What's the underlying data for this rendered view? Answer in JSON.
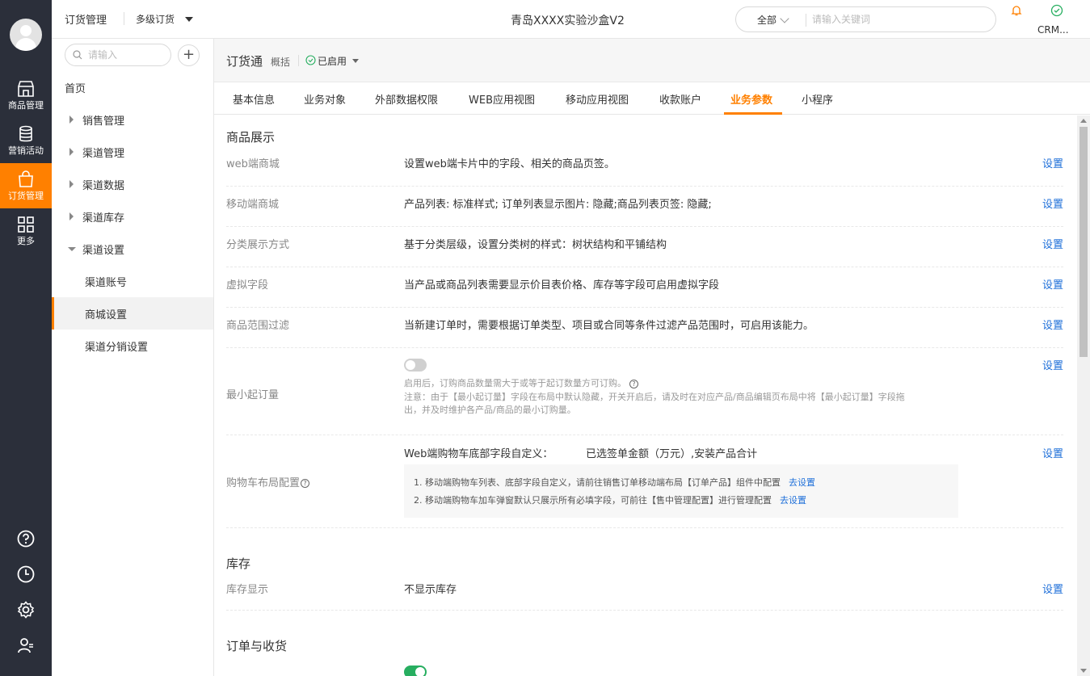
{
  "rail": {
    "items": [
      {
        "label": "商品管理",
        "icon": "store-icon"
      },
      {
        "label": "营销活动",
        "icon": "database-icon"
      },
      {
        "label": "订货管理",
        "icon": "shopping-bag-icon"
      },
      {
        "label": "更多",
        "icon": "grid-icon"
      }
    ],
    "active_index": 2
  },
  "header": {
    "crumb1": "订货管理",
    "crumb2": "多级订货",
    "center_title": "青岛XXXX实验沙盒V2",
    "search_scope": "全部",
    "search_placeholder": "请输入关键词",
    "crm_label": "CRM..."
  },
  "nav": {
    "search_placeholder": "请输入",
    "items": [
      {
        "label": "首页"
      },
      {
        "label": "销售管理"
      },
      {
        "label": "渠道管理"
      },
      {
        "label": "渠道数据"
      },
      {
        "label": "渠道库存"
      },
      {
        "label": "渠道设置"
      },
      {
        "label": "渠道账号"
      },
      {
        "label": "商城设置"
      },
      {
        "label": "渠道分销设置"
      }
    ]
  },
  "page": {
    "title": "订货通",
    "subtitle": "概括",
    "status": "已启用"
  },
  "tabs": [
    "基本信息",
    "业务对象",
    "外部数据权限",
    "WEB应用视图",
    "移动应用视图",
    "收款账户",
    "业务参数",
    "小程序"
  ],
  "active_tab": 6,
  "sections": {
    "product_display": "商品展示",
    "inventory": "库存",
    "order": "订单与收货"
  },
  "rows": {
    "web_mall": {
      "label": "web端商城",
      "value": "设置web端卡片中的字段、相关的商品页签。",
      "action": "设置"
    },
    "mobile_mall": {
      "label": "移动端商城",
      "value": "产品列表: 标准样式; 订单列表显示图片: 隐藏;商品列表页签: 隐藏;",
      "action": "设置"
    },
    "category": {
      "label": "分类展示方式",
      "value": "基于分类层级，设置分类树的样式：树状结构和平铺结构",
      "action": "设置"
    },
    "virtual": {
      "label": "虚拟字段",
      "value": "当产品或商品列表需要显示价目表价格、库存等字段可启用虚拟字段",
      "action": "设置"
    },
    "range": {
      "label": "商品范围过滤",
      "value": "当新建订单时，需要根据订单类型、项目或合同等条件过滤产品范围时，可启用该能力。",
      "action": "设置"
    },
    "min_qty": {
      "label": "最小起订量",
      "action": "设置",
      "hint1": "启用后，订购商品数量需大于或等于起订数量方可订购。",
      "hint2": "注意：由于【最小起订量】字段在布局中默认隐藏，开关开启后，请及时在对应产品/商品编辑页布局中将【最小起订量】字段拖",
      "hint3": "出，并及时维护各产品/商品的最小订购量。"
    },
    "cart": {
      "label": "购物车布局配置",
      "value_label": "Web端购物车底部字段自定义：",
      "value": "已选签单金额（万元）,安装产品合计",
      "action": "设置",
      "tip1": "1. 移动端购物车列表、底部字段自定义，请前往销售订单移动端布局【订单产品】组件中配置",
      "tip1_link": "去设置",
      "tip2": "2. 移动端购物车加车弹窗默认只展示所有必填字段，可前往【售中管理配置】进行管理配置",
      "tip2_link": "去设置"
    },
    "stock": {
      "label": "库存显示",
      "value": "不显示库存",
      "action": "设置"
    }
  },
  "colors": {
    "accent": "#ff8000",
    "link": "#1e6fd9",
    "rail": "#2b2f3a",
    "toggle_on": "#27ae60"
  }
}
